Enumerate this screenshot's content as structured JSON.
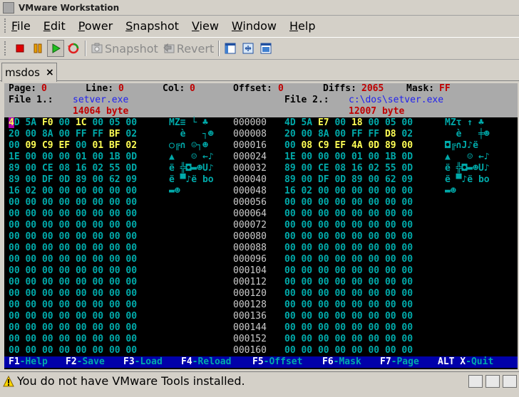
{
  "window": {
    "title": "VMware Workstation"
  },
  "menu": [
    {
      "u": "F",
      "rest": "ile"
    },
    {
      "u": "E",
      "rest": "dit"
    },
    {
      "u": "P",
      "rest": "ower"
    },
    {
      "u": "S",
      "rest": "napshot"
    },
    {
      "u": "V",
      "rest": "iew"
    },
    {
      "u": "W",
      "rest": "indow"
    },
    {
      "u": "H",
      "rest": "elp"
    }
  ],
  "toolbar": {
    "snapshot_label": "Snapshot",
    "revert_label": "Revert"
  },
  "tab": {
    "label": "msdos",
    "close": "×"
  },
  "dos": {
    "header": {
      "page_label": "Page:",
      "page": "0",
      "line_label": "Line:",
      "line": "0",
      "col_label": "Col:",
      "col": "0",
      "offset_label": "Offset:",
      "offset": "0",
      "diffs_label": "Diffs:",
      "diffs": "2065",
      "mask_label": "Mask:",
      "mask": "FF",
      "file1_label": "File 1.:",
      "file1": "setver.exe",
      "file1_size": "14064 byte",
      "file2_label": "File 2.:",
      "file2": "c:\\dos\\setver.exe",
      "file2_size": "12007 byte"
    },
    "rows": [
      {
        "o": "000000",
        "a": "4D 5A F0 00 1C 00 05 00",
        "ad": "00 00 11 00 11 00 00 00",
        "ac": "MZ≡ └ ♣",
        "b": "4D 5A E7 00 18 00 05 00",
        "bd": "00 00 11 00 11 00 00 00",
        "bc": "MZτ ↑ ♣"
      },
      {
        "o": "000008",
        "a": "20 00 8A 00 FF FF BF 02",
        "ad": "00 00 00 00 00 00 11 00",
        "ac": "  è   ┐☻",
        "b": "20 00 8A 00 FF FF D8 02",
        "bd": "00 00 00 00 00 00 11 00",
        "bc": "  è   ╪☻"
      },
      {
        "o": "000016",
        "a": "00 09 C9 EF 00 01 BF 02",
        "ad": "00 11 11 11 00 11 11 11",
        "ac": "○╔∩ ☺┐☻",
        "b": "00 08 C9 EF 4A 0D 89 00",
        "bd": "00 11 11 11 11 11 11 11",
        "bc": "◘╔∩J♪ë "
      },
      {
        "o": "000024",
        "a": "1E 00 00 00 01 00 1B 0D",
        "ad": "00 00 00 00 00 00 00 00",
        "ac": "▲   ☺ ←♪",
        "b": "1E 00 00 00 01 00 1B 0D",
        "bd": "00 00 00 00 00 00 00 00",
        "bc": "▲   ☺ ←♪"
      },
      {
        "o": "000032",
        "a": "89 00 CE 08 16 02 55 0D",
        "ad": "00 00 00 00 00 00 00 00",
        "ac": "ë ╬◘▬☻U♪",
        "b": "89 00 CE 08 16 02 55 0D",
        "bd": "00 00 00 00 00 00 00 00",
        "bc": "ë ╬◘▬☻U♪"
      },
      {
        "o": "000040",
        "a": "89 00 DF 0D 89 00 62 09",
        "ad": "00 00 00 00 00 00 00 00",
        "ac": "ë ▀♪ë bo",
        "b": "89 00 DF 0D 89 00 62 09",
        "bd": "00 00 00 00 00 00 00 00",
        "bc": "ë ▀♪ë bo"
      },
      {
        "o": "000048",
        "a": "16 02 00 00 00 00 00 00",
        "ad": "00 00 00 00 00 00 00 00",
        "ac": "▬☻",
        "b": "16 02 00 00 00 00 00 00",
        "bd": "00 00 00 00 00 00 00 00",
        "bc": "▬☻"
      },
      {
        "o": "000056",
        "a": "00 00 00 00 00 00 00 00",
        "ad": "00 00 00 00 00 00 00 00",
        "ac": "",
        "b": "00 00 00 00 00 00 00 00",
        "bd": "00 00 00 00 00 00 00 00",
        "bc": ""
      },
      {
        "o": "000064",
        "a": "00 00 00 00 00 00 00 00",
        "ad": "00 00 00 00 00 00 00 00",
        "ac": "",
        "b": "00 00 00 00 00 00 00 00",
        "bd": "00 00 00 00 00 00 00 00",
        "bc": ""
      },
      {
        "o": "000072",
        "a": "00 00 00 00 00 00 00 00",
        "ad": "00 00 00 00 00 00 00 00",
        "ac": "",
        "b": "00 00 00 00 00 00 00 00",
        "bd": "00 00 00 00 00 00 00 00",
        "bc": ""
      },
      {
        "o": "000080",
        "a": "00 00 00 00 00 00 00 00",
        "ad": "00 00 00 00 00 00 00 00",
        "ac": "",
        "b": "00 00 00 00 00 00 00 00",
        "bd": "00 00 00 00 00 00 00 00",
        "bc": ""
      },
      {
        "o": "000088",
        "a": "00 00 00 00 00 00 00 00",
        "ad": "00 00 00 00 00 00 00 00",
        "ac": "",
        "b": "00 00 00 00 00 00 00 00",
        "bd": "00 00 00 00 00 00 00 00",
        "bc": ""
      },
      {
        "o": "000096",
        "a": "00 00 00 00 00 00 00 00",
        "ad": "00 00 00 00 00 00 00 00",
        "ac": "",
        "b": "00 00 00 00 00 00 00 00",
        "bd": "00 00 00 00 00 00 00 00",
        "bc": ""
      },
      {
        "o": "000104",
        "a": "00 00 00 00 00 00 00 00",
        "ad": "00 00 00 00 00 00 00 00",
        "ac": "",
        "b": "00 00 00 00 00 00 00 00",
        "bd": "00 00 00 00 00 00 00 00",
        "bc": ""
      },
      {
        "o": "000112",
        "a": "00 00 00 00 00 00 00 00",
        "ad": "00 00 00 00 00 00 00 00",
        "ac": "",
        "b": "00 00 00 00 00 00 00 00",
        "bd": "00 00 00 00 00 00 00 00",
        "bc": ""
      },
      {
        "o": "000120",
        "a": "00 00 00 00 00 00 00 00",
        "ad": "00 00 00 00 00 00 00 00",
        "ac": "",
        "b": "00 00 00 00 00 00 00 00",
        "bd": "00 00 00 00 00 00 00 00",
        "bc": ""
      },
      {
        "o": "000128",
        "a": "00 00 00 00 00 00 00 00",
        "ad": "00 00 00 00 00 00 00 00",
        "ac": "",
        "b": "00 00 00 00 00 00 00 00",
        "bd": "00 00 00 00 00 00 00 00",
        "bc": ""
      },
      {
        "o": "000136",
        "a": "00 00 00 00 00 00 00 00",
        "ad": "00 00 00 00 00 00 00 00",
        "ac": "",
        "b": "00 00 00 00 00 00 00 00",
        "bd": "00 00 00 00 00 00 00 00",
        "bc": ""
      },
      {
        "o": "000144",
        "a": "00 00 00 00 00 00 00 00",
        "ad": "00 00 00 00 00 00 00 00",
        "ac": "",
        "b": "00 00 00 00 00 00 00 00",
        "bd": "00 00 00 00 00 00 00 00",
        "bc": ""
      },
      {
        "o": "000152",
        "a": "00 00 00 00 00 00 00 00",
        "ad": "00 00 00 00 00 00 00 00",
        "ac": "",
        "b": "00 00 00 00 00 00 00 00",
        "bd": "00 00 00 00 00 00 00 00",
        "bc": ""
      },
      {
        "o": "000160",
        "a": "00 00 00 00 00 00 00 00",
        "ad": "00 00 00 00 00 00 00 00",
        "ac": "",
        "b": "00 00 00 00 00 00 00 00",
        "bd": "00 00 00 00 00 00 00 00",
        "bc": ""
      }
    ],
    "fkeys": [
      {
        "k": "F1",
        "l": "-Help"
      },
      {
        "k": "F2",
        "l": "-Save"
      },
      {
        "k": "F3",
        "l": "-Load"
      },
      {
        "k": "F4",
        "l": "-Reload"
      },
      {
        "k": "F5",
        "l": "-Offset"
      },
      {
        "k": "F6",
        "l": "-Mask"
      },
      {
        "k": "F7",
        "l": "-Page"
      },
      {
        "k": "ALT X",
        "l": "-Quit"
      }
    ]
  },
  "status": {
    "message": "You do not have VMware Tools installed."
  },
  "colors": {
    "dos_bg": "#000000",
    "dos_cyan": "#00aaaa",
    "dos_yellow": "#ffff55",
    "dos_header": "#aaaaaa",
    "dos_fbar": "#0000aa",
    "accent_red": "#c00000",
    "accent_blue": "#2222ee"
  }
}
